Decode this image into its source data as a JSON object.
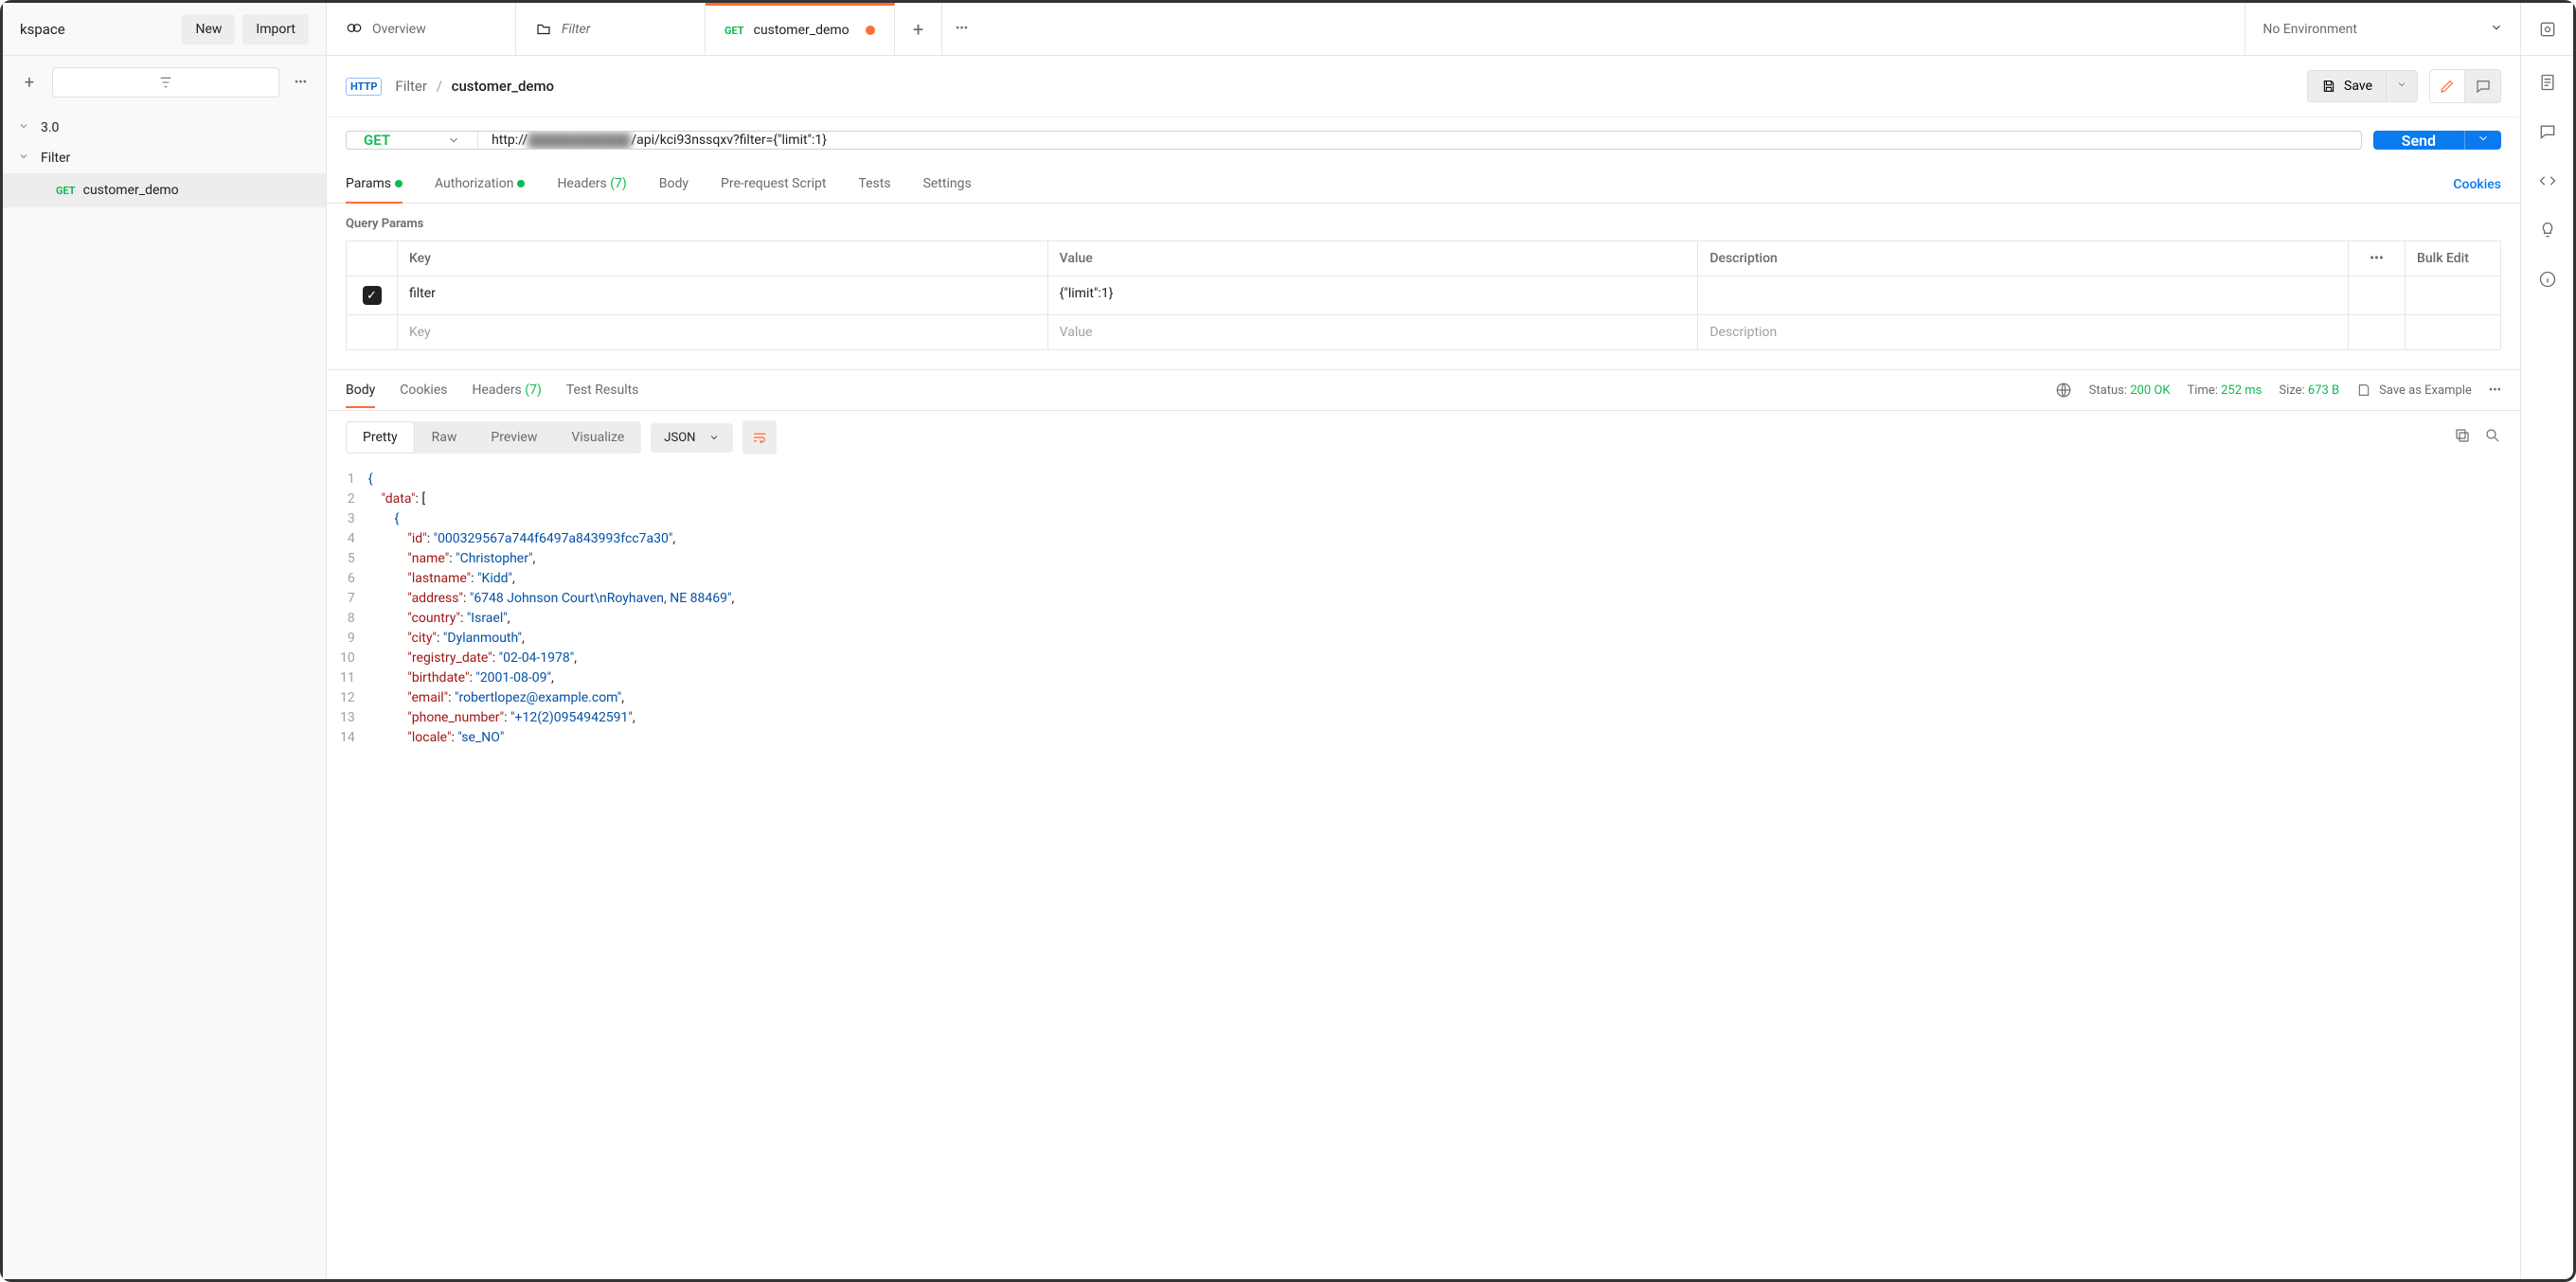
{
  "workspace": {
    "label": "kspace",
    "new": "New",
    "import": "Import"
  },
  "tabs": {
    "overview": "Overview",
    "filter": "Filter",
    "request": {
      "method": "GET",
      "name": "customer_demo"
    },
    "env": "No Environment"
  },
  "sidebar": {
    "items": [
      "3.0",
      "Filter"
    ],
    "child": {
      "method": "GET",
      "name": "customer_demo"
    }
  },
  "crumb": {
    "folder": "Filter",
    "name": "customer_demo",
    "save": "Save"
  },
  "request": {
    "method": "GET",
    "url_prefix": "http://",
    "url_blur": "███████████",
    "url_suffix": "/api/kci93nssqxv?filter={\"limit\":1}",
    "send": "Send"
  },
  "reqtabs": {
    "params": "Params",
    "auth": "Authorization",
    "headers": "Headers",
    "headers_count": "(7)",
    "body": "Body",
    "prereq": "Pre-request Script",
    "tests": "Tests",
    "settings": "Settings",
    "cookies": "Cookies"
  },
  "qp": {
    "title": "Query Params",
    "cols": {
      "key": "Key",
      "value": "Value",
      "desc": "Description",
      "bulk": "Bulk Edit"
    },
    "rows": [
      {
        "key": "filter",
        "value": "{\"limit\":1}"
      }
    ],
    "ph": {
      "key": "Key",
      "value": "Value",
      "desc": "Description"
    }
  },
  "resptabs": {
    "body": "Body",
    "cookies": "Cookies",
    "headers": "Headers",
    "headers_count": "(7)",
    "tests": "Test Results"
  },
  "meta": {
    "status_l": "Status:",
    "status": "200 OK",
    "time_l": "Time:",
    "time": "252 ms",
    "size_l": "Size:",
    "size": "673 B",
    "save": "Save as Example"
  },
  "view": {
    "pretty": "Pretty",
    "raw": "Raw",
    "preview": "Preview",
    "visualize": "Visualize",
    "fmt": "JSON"
  },
  "response_body": {
    "data": [
      {
        "id": "000329567a744f6497a843993fcc7a30",
        "name": "Christopher",
        "lastname": "Kidd",
        "address": "6748 Johnson Court\\nRoyhaven, NE 88469",
        "country": "Israel",
        "city": "Dylanmouth",
        "registry_date": "02-04-1978",
        "birthdate": "2001-08-09",
        "email": "robertlopez@example.com",
        "phone_number": "+12(2)0954942591",
        "locale": "se_NO"
      }
    ]
  },
  "code_lines": [
    1,
    2,
    3,
    4,
    5,
    6,
    7,
    8,
    9,
    10,
    11,
    12,
    13,
    14
  ]
}
